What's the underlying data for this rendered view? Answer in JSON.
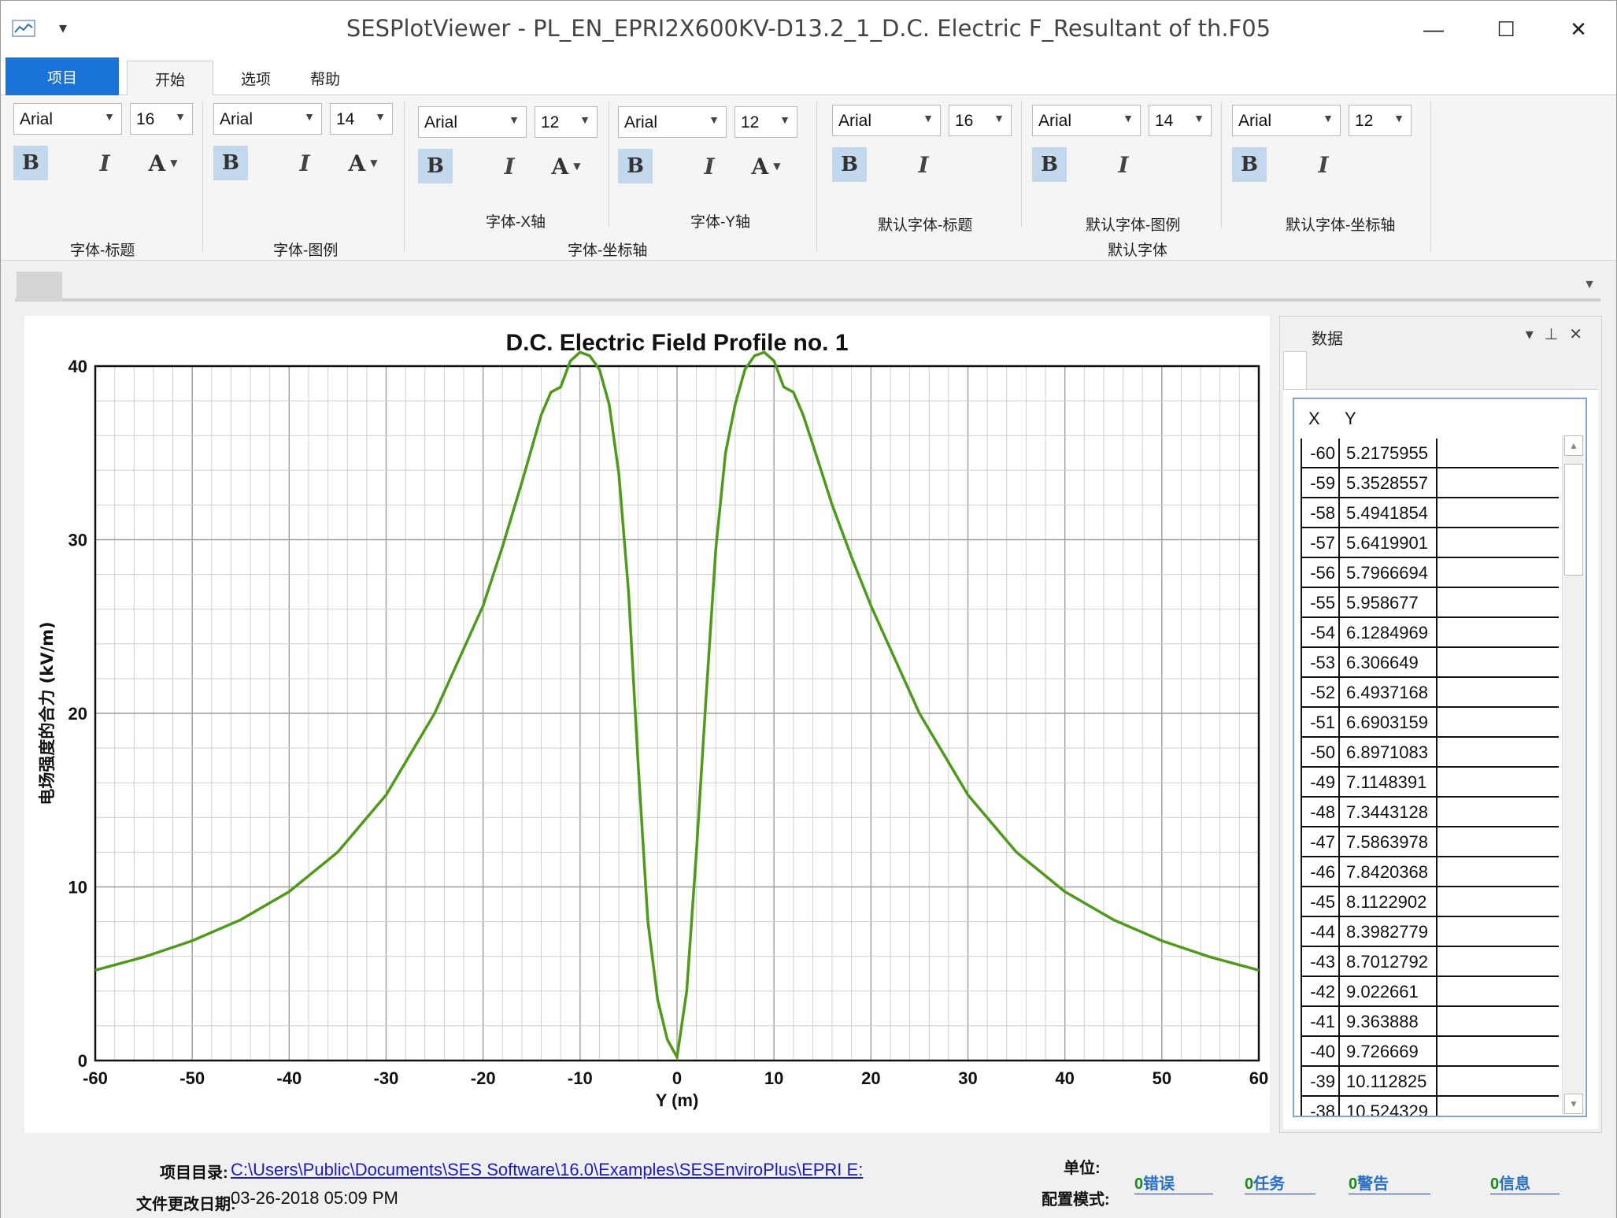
{
  "window": {
    "title": "SESPlotViewer - PL_EN_EPRI2X600KV-D13.2_1_D.C. Electric F_Resultant of th.F05",
    "minimize": "—",
    "maximize": "☐",
    "close": "✕"
  },
  "tabs": {
    "project": "项目",
    "start": "开始",
    "options": "选项",
    "help": "帮助"
  },
  "ribbon": {
    "g1": {
      "font": "Arial",
      "size": "16",
      "label": "字体-标题"
    },
    "g2": {
      "font": "Arial",
      "size": "14",
      "label": "字体-图例"
    },
    "g3": {
      "font": "Arial",
      "size": "12",
      "label": "字体-X轴"
    },
    "g4": {
      "font": "Arial",
      "size": "12",
      "label": "字体-Y轴"
    },
    "axes_label": "字体-坐标轴",
    "g5": {
      "font": "Arial",
      "size": "16",
      "label": "默认字体-标题"
    },
    "g6": {
      "font": "Arial",
      "size": "14",
      "label": "默认字体-图例"
    },
    "g7": {
      "font": "Arial",
      "size": "12",
      "label": "默认字体-坐标轴"
    },
    "default_label": "默认字体",
    "bold": "B",
    "italic": "I",
    "color": "A"
  },
  "chart_data": {
    "type": "line",
    "title": "D.C. Electric Field Profile no.  1",
    "xlabel": "Y (m)",
    "ylabel": "电场强度的合力 (kV/m)",
    "xlim": [
      -60,
      60
    ],
    "ylim": [
      0,
      40
    ],
    "xticks": [
      "-60",
      "-50",
      "-40",
      "-30",
      "-20",
      "-10",
      "0",
      "10",
      "20",
      "30",
      "40",
      "50",
      "60"
    ],
    "yticks": [
      "0",
      "10",
      "20",
      "30",
      "40"
    ],
    "grid": true,
    "line_color": "#4f9a1a",
    "series": [
      {
        "x": [
          -60,
          -55,
          -50,
          -45,
          -40,
          -35,
          -30,
          -25,
          -20,
          -18,
          -16,
          -14,
          -13,
          -12,
          -11,
          -10,
          -9,
          -8,
          -7,
          -6,
          -5,
          -4,
          -3,
          -2,
          -1,
          0,
          1,
          2,
          3,
          4,
          5,
          6,
          7,
          8,
          9,
          10,
          11,
          12,
          13,
          14,
          16,
          18,
          20,
          25,
          30,
          35,
          40,
          45,
          50,
          55,
          60
        ],
        "y": [
          5.2,
          5.96,
          6.9,
          8.11,
          9.73,
          12.0,
          15.3,
          20.0,
          26.2,
          29.6,
          33.3,
          37.2,
          38.5,
          38.8,
          40.3,
          40.8,
          40.6,
          39.8,
          37.8,
          33.8,
          27.0,
          17.0,
          8.0,
          3.5,
          1.2,
          0.2,
          4.0,
          12.0,
          21.0,
          29.5,
          35.0,
          37.8,
          39.8,
          40.6,
          40.8,
          40.3,
          38.8,
          38.5,
          37.2,
          35.5,
          32.0,
          29.0,
          26.2,
          20.0,
          15.3,
          12.0,
          9.73,
          8.11,
          6.9,
          5.96,
          5.2
        ]
      }
    ]
  },
  "data_panel": {
    "title": "数据",
    "col_x": "X",
    "col_y": "Y",
    "rows": [
      {
        "x": "-60",
        "y": "5.2175955"
      },
      {
        "x": "-59",
        "y": "5.3528557"
      },
      {
        "x": "-58",
        "y": "5.4941854"
      },
      {
        "x": "-57",
        "y": "5.6419901"
      },
      {
        "x": "-56",
        "y": "5.7966694"
      },
      {
        "x": "-55",
        "y": "5.958677"
      },
      {
        "x": "-54",
        "y": "6.1284969"
      },
      {
        "x": "-53",
        "y": "6.306649"
      },
      {
        "x": "-52",
        "y": "6.4937168"
      },
      {
        "x": "-51",
        "y": "6.6903159"
      },
      {
        "x": "-50",
        "y": "6.8971083"
      },
      {
        "x": "-49",
        "y": "7.1148391"
      },
      {
        "x": "-48",
        "y": "7.3443128"
      },
      {
        "x": "-47",
        "y": "7.5863978"
      },
      {
        "x": "-46",
        "y": "7.8420368"
      },
      {
        "x": "-45",
        "y": "8.1122902"
      },
      {
        "x": "-44",
        "y": "8.3982779"
      },
      {
        "x": "-43",
        "y": "8.7012792"
      },
      {
        "x": "-42",
        "y": "9.022661"
      },
      {
        "x": "-41",
        "y": "9.363888"
      },
      {
        "x": "-40",
        "y": "9.726669"
      },
      {
        "x": "-39",
        "y": "10.112825"
      },
      {
        "x": "-38",
        "y": "10.524329"
      }
    ]
  },
  "status": {
    "project_dir_label": "项目目录:",
    "project_dir": "C:\\Users\\Public\\Documents\\SES Software\\16.0\\Examples\\SESEnviroPlus\\EPRI E:",
    "modified_label": "文件更改日期:",
    "modified": "03-26-2018 05:09 PM",
    "unit_label": "单位:",
    "config_label": "配置模式:",
    "errors_count": "0",
    "errors": "错误",
    "tasks_count": "0",
    "tasks": "任务",
    "warnings_count": "0",
    "warnings": "警告",
    "info_count": "0",
    "info": "信息"
  }
}
